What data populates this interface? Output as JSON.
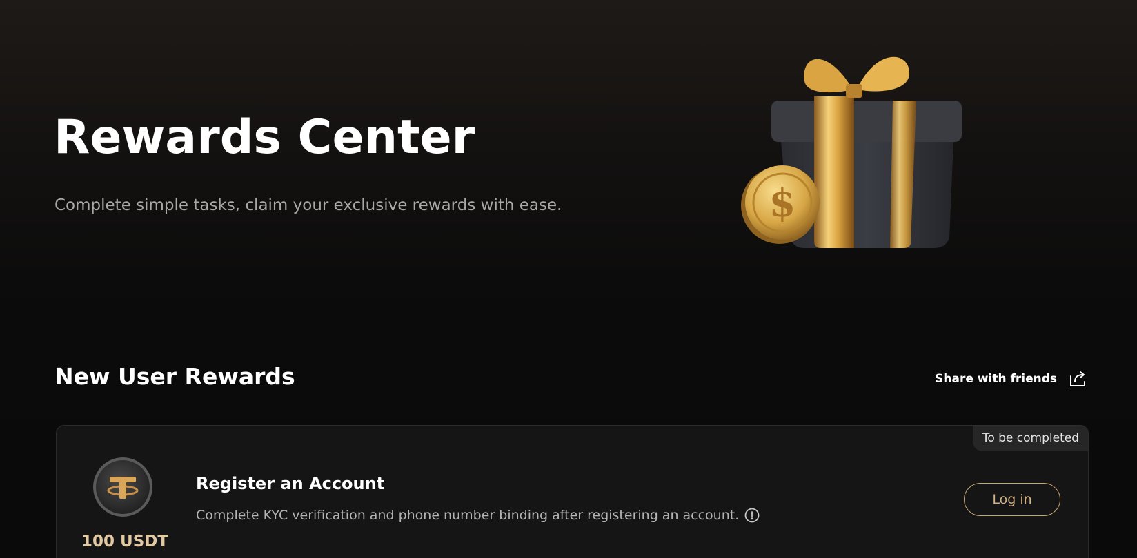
{
  "hero": {
    "title": "Rewards Center",
    "subtitle": "Complete simple tasks, claim your exclusive rewards with ease."
  },
  "section": {
    "title": "New User Rewards",
    "share_label": "Share with friends"
  },
  "task": {
    "status": "To be completed",
    "reward_amount": "100 USDT",
    "title": "Register an Account",
    "description": "Complete KYC verification and phone number binding after registering an account.",
    "button_label": "Log in"
  },
  "icons": {
    "share": "share-icon",
    "info": "info-icon",
    "token": "tether-token-icon",
    "gift": "gift-box-illustration"
  },
  "colors": {
    "background": "#0a0a0a",
    "gold_accent": "#c9a774",
    "reward_text": "#e2c9a2",
    "card": "#151515"
  }
}
